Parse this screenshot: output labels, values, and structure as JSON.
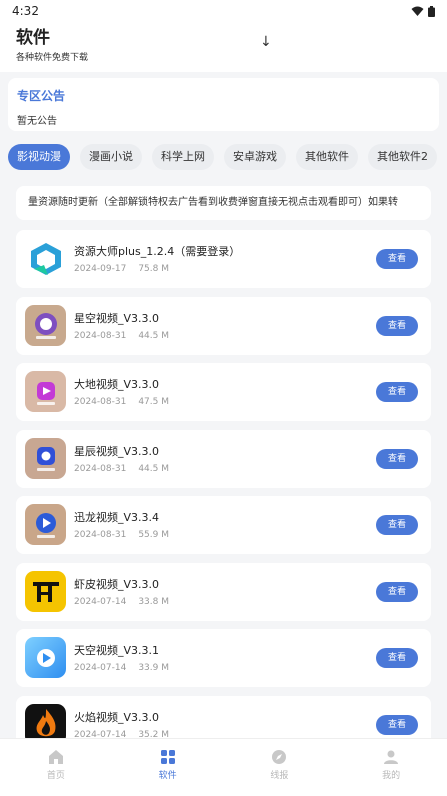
{
  "status": {
    "time": "4:32"
  },
  "header": {
    "title": "软件",
    "subtitle": "各种软件免费下载"
  },
  "notice": {
    "title": "专区公告",
    "body": "暂无公告"
  },
  "tabs": [
    "影视动漫",
    "漫画小说",
    "科学上网",
    "安卓游戏",
    "其他软件",
    "其他软件2"
  ],
  "marquee": "量资源随时更新（全部解锁特权去广告看到收费弹窗直接无视点击观看即可）如果转",
  "items": [
    {
      "name": "资源大师plus_1.2.4（需要登录）",
      "date": "2024-09-17",
      "size": "75.8 M",
      "button": "查看"
    },
    {
      "name": "星空视频_V3.3.0",
      "date": "2024-08-31",
      "size": "44.5 M",
      "button": "查看"
    },
    {
      "name": "大地视频_V3.3.0",
      "date": "2024-08-31",
      "size": "47.5 M",
      "button": "查看"
    },
    {
      "name": "星辰视频_V3.3.0",
      "date": "2024-08-31",
      "size": "44.5 M",
      "button": "查看"
    },
    {
      "name": "迅龙视频_V3.3.4",
      "date": "2024-08-31",
      "size": "55.9 M",
      "button": "查看"
    },
    {
      "name": "虾皮视频_V3.3.0",
      "date": "2024-07-14",
      "size": "33.8 M",
      "button": "查看"
    },
    {
      "name": "天空视频_V3.3.1",
      "date": "2024-07-14",
      "size": "33.9 M",
      "button": "查看"
    },
    {
      "name": "火焰视频_V3.3.0",
      "date": "2024-07-14",
      "size": "35.2 M",
      "button": "查看"
    }
  ],
  "nav": {
    "home": "首页",
    "software": "软件",
    "live": "线报",
    "mine": "我的"
  },
  "colors": {
    "accent": "#4a78d8"
  }
}
